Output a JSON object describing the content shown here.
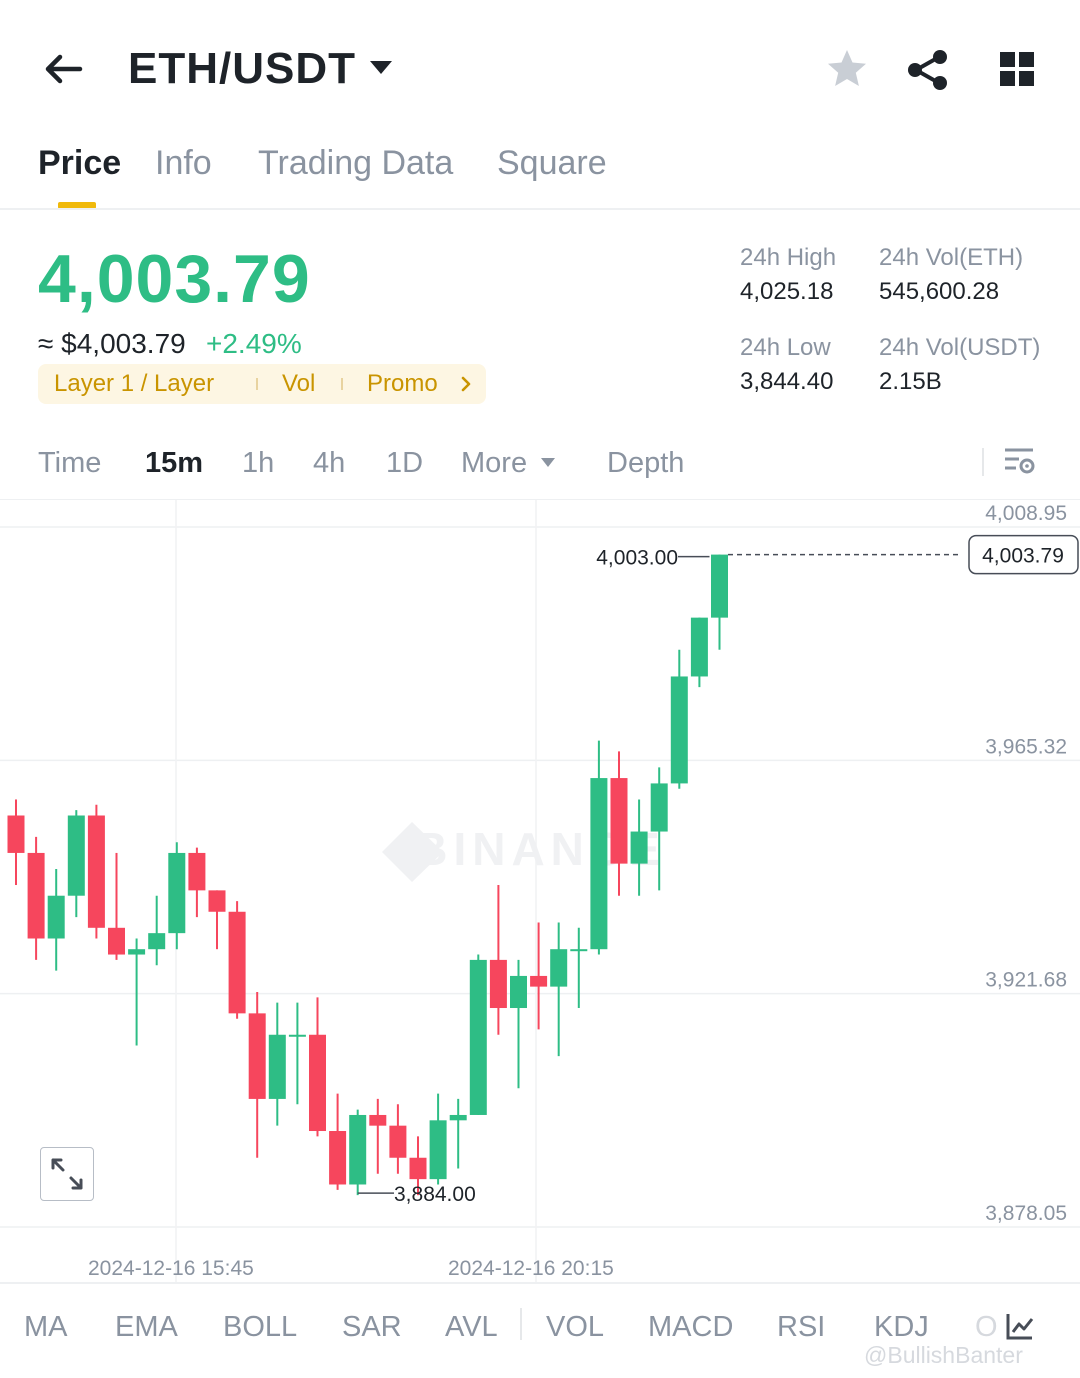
{
  "header": {
    "pair": "ETH/USDT",
    "icons": [
      "back-arrow-icon",
      "caret-down-icon",
      "star-icon",
      "share-icon",
      "grid-icon"
    ]
  },
  "tabs": [
    {
      "label": "Price",
      "active": true
    },
    {
      "label": "Info",
      "active": false
    },
    {
      "label": "Trading Data",
      "active": false
    },
    {
      "label": "Square",
      "active": false
    }
  ],
  "price": {
    "last": "4,003.79",
    "fiat": "≈ $4,003.79",
    "change": "+2.49%"
  },
  "tags": [
    "Layer 1 / Layer",
    "Vol",
    "Promo"
  ],
  "stats": {
    "high_label": "24h High",
    "high_value": "4,025.18",
    "low_label": "24h Low",
    "low_value": "3,844.40",
    "vol_eth_label": "24h Vol(ETH)",
    "vol_eth_value": "545,600.28",
    "vol_usdt_label": "24h Vol(USDT)",
    "vol_usdt_value": "2.15B"
  },
  "intervals": {
    "items": [
      "Time",
      "15m",
      "1h",
      "4h",
      "1D",
      "More"
    ],
    "active": "15m",
    "depth": "Depth"
  },
  "chart_data": {
    "type": "candlestick",
    "interval": "15m",
    "y_ticks": [
      "4,008.95",
      "3,965.32",
      "3,921.68",
      "3,878.05"
    ],
    "ylim": [
      3878.05,
      4008.95
    ],
    "x_ticks": [
      "2024-12-16 15:45",
      "2024-12-16 20:15"
    ],
    "current_price_label": "4,003.79",
    "high_marker": "4,003.00",
    "low_marker": "3,884.00",
    "candles": [
      {
        "o": 3955,
        "h": 3958,
        "l": 3942,
        "c": 3948
      },
      {
        "o": 3948,
        "h": 3951,
        "l": 3928,
        "c": 3932
      },
      {
        "o": 3932,
        "h": 3945,
        "l": 3926,
        "c": 3940
      },
      {
        "o": 3940,
        "h": 3956,
        "l": 3936,
        "c": 3955
      },
      {
        "o": 3955,
        "h": 3957,
        "l": 3932,
        "c": 3934
      },
      {
        "o": 3934,
        "h": 3948,
        "l": 3928,
        "c": 3929
      },
      {
        "o": 3929,
        "h": 3932,
        "l": 3912,
        "c": 3930
      },
      {
        "o": 3930,
        "h": 3940,
        "l": 3927,
        "c": 3933
      },
      {
        "o": 3933,
        "h": 3950,
        "l": 3930,
        "c": 3948
      },
      {
        "o": 3948,
        "h": 3949,
        "l": 3936,
        "c": 3941
      },
      {
        "o": 3941,
        "h": 3941,
        "l": 3930,
        "c": 3937
      },
      {
        "o": 3937,
        "h": 3939,
        "l": 3917,
        "c": 3918
      },
      {
        "o": 3918,
        "h": 3922,
        "l": 3891,
        "c": 3902
      },
      {
        "o": 3902,
        "h": 3920,
        "l": 3897,
        "c": 3914
      },
      {
        "o": 3914,
        "h": 3920,
        "l": 3901,
        "c": 3914
      },
      {
        "o": 3914,
        "h": 3921,
        "l": 3895,
        "c": 3896
      },
      {
        "o": 3896,
        "h": 3903,
        "l": 3885,
        "c": 3886
      },
      {
        "o": 3886,
        "h": 3900,
        "l": 3884,
        "c": 3899
      },
      {
        "o": 3899,
        "h": 3902,
        "l": 3888,
        "c": 3897
      },
      {
        "o": 3897,
        "h": 3901,
        "l": 3888,
        "c": 3891
      },
      {
        "o": 3891,
        "h": 3895,
        "l": 3884,
        "c": 3887
      },
      {
        "o": 3887,
        "h": 3903,
        "l": 3886,
        "c": 3898
      },
      {
        "o": 3898,
        "h": 3902,
        "l": 3889,
        "c": 3899
      },
      {
        "o": 3899,
        "h": 3929,
        "l": 3899,
        "c": 3928
      },
      {
        "o": 3928,
        "h": 3942,
        "l": 3914,
        "c": 3919
      },
      {
        "o": 3919,
        "h": 3928,
        "l": 3904,
        "c": 3925
      },
      {
        "o": 3925,
        "h": 3935,
        "l": 3915,
        "c": 3923
      },
      {
        "o": 3923,
        "h": 3935,
        "l": 3910,
        "c": 3930
      },
      {
        "o": 3930,
        "h": 3934,
        "l": 3919,
        "c": 3930
      },
      {
        "o": 3930,
        "h": 3969,
        "l": 3929,
        "c": 3962
      },
      {
        "o": 3962,
        "h": 3967,
        "l": 3940,
        "c": 3946
      },
      {
        "o": 3946,
        "h": 3958,
        "l": 3940,
        "c": 3952
      },
      {
        "o": 3952,
        "h": 3964,
        "l": 3941,
        "c": 3961
      },
      {
        "o": 3961,
        "h": 3986,
        "l": 3960,
        "c": 3981
      },
      {
        "o": 3981,
        "h": 3992,
        "l": 3979,
        "c": 3992
      },
      {
        "o": 3992,
        "h": 4003.79,
        "l": 3986,
        "c": 4003.79
      }
    ]
  },
  "indicators": [
    "MA",
    "EMA",
    "BOLL",
    "SAR",
    "AVL",
    "VOL",
    "MACD",
    "RSI",
    "KDJ",
    "O"
  ],
  "colors": {
    "up": "#2ebd85",
    "down": "#f6465d",
    "accent": "#f0b90b",
    "muted": "#8a93a0",
    "text": "#1e2329"
  },
  "watermark": "@BullishBanter",
  "chart_watermark": "BINANCE"
}
